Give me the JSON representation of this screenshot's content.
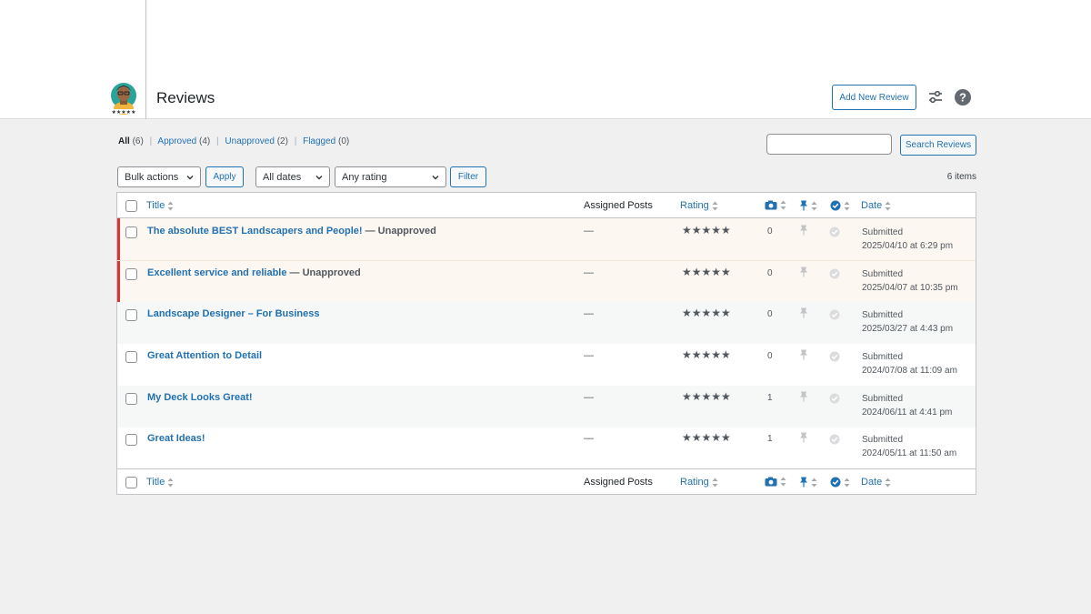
{
  "header": {
    "title": "Reviews",
    "add_new_label": "Add New Review"
  },
  "views": [
    {
      "label": "All",
      "count": "(6)"
    },
    {
      "label": "Approved",
      "count": "(4)"
    },
    {
      "label": "Unapproved",
      "count": "(2)"
    },
    {
      "label": "Flagged",
      "count": "(0)"
    }
  ],
  "search": {
    "value": "",
    "button_label": "Search Reviews"
  },
  "filters": {
    "bulk_actions": "Bulk actions",
    "apply_label": "Apply",
    "dates": "All dates",
    "rating": "Any rating",
    "filter_label": "Filter",
    "items_count": "6 items"
  },
  "columns": {
    "title": "Title",
    "assigned_posts": "Assigned Posts",
    "rating": "Rating",
    "date": "Date"
  },
  "rows": [
    {
      "title": "The absolute BEST Landscapers and People!",
      "state": " — Unapproved",
      "assigned": "—",
      "stars": "★★★★★",
      "rating": 5,
      "photos": "0",
      "status": "Submitted",
      "date": "2025/04/10 at 6:29 pm"
    },
    {
      "title": "Excellent service and reliable",
      "state": " — Unapproved",
      "assigned": "—",
      "stars": "★★★★★",
      "rating": 5,
      "photos": "0",
      "status": "Submitted",
      "date": "2025/04/07 at 10:35 pm"
    },
    {
      "title": "Landscape Designer – For Business",
      "state": "",
      "assigned": "—",
      "stars": "★★★★★",
      "rating": 5,
      "photos": "0",
      "status": "Submitted",
      "date": "2025/03/27 at 4:43 pm"
    },
    {
      "title": "Great Attention to Detail",
      "state": "",
      "assigned": "—",
      "stars": "★★★★★",
      "rating": 5,
      "photos": "0",
      "status": "Submitted",
      "date": "2024/07/08 at 11:09 am"
    },
    {
      "title": "My Deck Looks Great!",
      "state": "",
      "assigned": "—",
      "stars": "★★★★★",
      "rating": 5,
      "photos": "1",
      "status": "Submitted",
      "date": "2024/06/11 at 4:41 pm"
    },
    {
      "title": "Great Ideas!",
      "state": "",
      "assigned": "—",
      "stars": "★★★★★",
      "rating": 5,
      "photos": "1",
      "status": "Submitted",
      "date": "2024/05/11 at 11:50 am"
    }
  ],
  "colors": {
    "link": "#2271b1",
    "unapproved_bar": "#d63638",
    "unapproved_bg": "#fdf7f1"
  },
  "icons": {
    "logo": "reviewer-avatar-logo",
    "settings": "sliders-icon",
    "help": "help-circle-icon",
    "photos_column": "camera-icon",
    "pinned_column": "pin-icon",
    "verified_column": "check-circle-icon"
  }
}
